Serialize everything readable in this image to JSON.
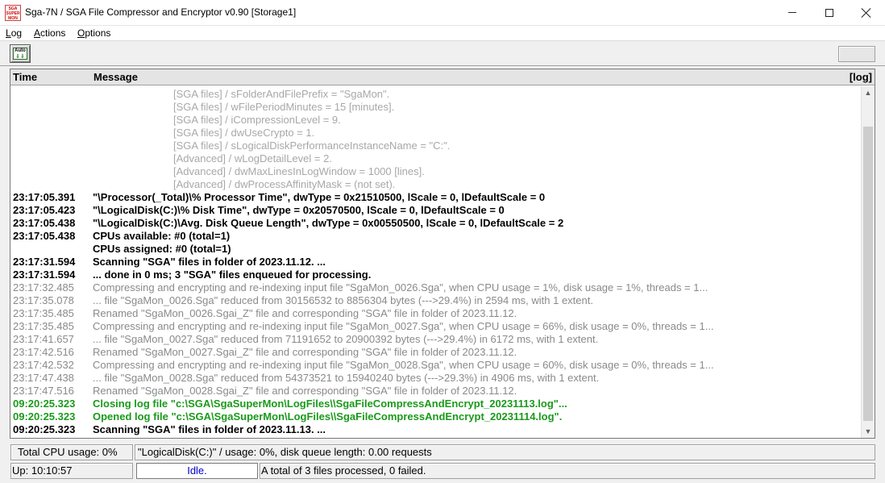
{
  "window": {
    "title": "Sga-7N / SGA File Compressor and Encryptor  v0.90  [Storage1]",
    "icon_lines": [
      "SGA",
      "SUPER",
      "MON"
    ]
  },
  "menu": [
    {
      "accel": "L",
      "rest": "og"
    },
    {
      "accel": "A",
      "rest": "ctions"
    },
    {
      "accel": "O",
      "rest": "ptions"
    }
  ],
  "toolbar": {
    "auto_label": "Auto",
    "auto_arrows": "⇓⇓"
  },
  "list": {
    "headers": {
      "time": "Time",
      "message": "Message",
      "log": "[log]"
    },
    "rows": [
      {
        "style": "cfg",
        "time": "",
        "msg": "[SGA files] / sFolderAndFilePrefix = \"SgaMon\"."
      },
      {
        "style": "cfg",
        "time": "",
        "msg": "[SGA files] / wFilePeriodMinutes = 15 [minutes]."
      },
      {
        "style": "cfg",
        "time": "",
        "msg": "[SGA files] / iCompressionLevel = 9."
      },
      {
        "style": "cfg",
        "time": "",
        "msg": "[SGA files] / dwUseCrypto = 1."
      },
      {
        "style": "cfg",
        "time": "",
        "msg": "[SGA files] / sLogicalDiskPerformanceInstanceName = \"C:\"."
      },
      {
        "style": "cfg",
        "time": "",
        "msg": "[Advanced] / wLogDetailLevel = 2."
      },
      {
        "style": "cfg",
        "time": "",
        "msg": "[Advanced] / dwMaxLinesInLogWindow = 1000 [lines]."
      },
      {
        "style": "cfg",
        "time": "",
        "msg": "[Advanced] / dwProcessAffinityMask = (not set)."
      },
      {
        "style": "black",
        "time": "23:17:05.391",
        "msg": "\"\\Processor(_Total)\\% Processor Time\", dwType = 0x21510500, lScale = 0, lDefaultScale = 0"
      },
      {
        "style": "black",
        "time": "23:17:05.423",
        "msg": "\"\\LogicalDisk(C:)\\% Disk Time\", dwType = 0x20570500, lScale = 0, lDefaultScale = 0"
      },
      {
        "style": "black",
        "time": "23:17:05.438",
        "msg": "\"\\LogicalDisk(C:)\\Avg. Disk Queue Length\", dwType = 0x00550500, lScale = 0, lDefaultScale = 2"
      },
      {
        "style": "black",
        "time": "23:17:05.438",
        "msg": "CPUs available: #0  (total=1)"
      },
      {
        "style": "black",
        "time": "",
        "msg": "CPUs assigned: #0  (total=1)"
      },
      {
        "style": "black",
        "time": "23:17:31.594",
        "msg": "Scanning \"SGA\" files in folder of 2023.11.12. ..."
      },
      {
        "style": "black",
        "time": "23:17:31.594",
        "msg": "... done in 0 ms; 3 \"SGA\" files enqueued for processing."
      },
      {
        "style": "gray",
        "time": "23:17:32.485",
        "msg": "Compressing and encrypting and re-indexing input file \"SgaMon_0026.Sga\", when CPU usage = 1%, disk usage = 1%, threads = 1..."
      },
      {
        "style": "gray",
        "time": "23:17:35.078",
        "msg": "... file \"SgaMon_0026.Sga\" reduced from 30156532 to 8856304 bytes (--->29.4%) in 2594 ms, with 1 extent."
      },
      {
        "style": "gray",
        "time": "23:17:35.485",
        "msg": "Renamed \"SgaMon_0026.Sgai_Z\" file and corresponding \"SGA\" file in folder of 2023.11.12."
      },
      {
        "style": "gray",
        "time": "23:17:35.485",
        "msg": "Compressing and encrypting and re-indexing input file \"SgaMon_0027.Sga\", when CPU usage = 66%, disk usage = 0%, threads = 1..."
      },
      {
        "style": "gray",
        "time": "23:17:41.657",
        "msg": "... file \"SgaMon_0027.Sga\" reduced from 71191652 to 20900392 bytes (--->29.4%) in 6172 ms, with 1 extent."
      },
      {
        "style": "gray",
        "time": "23:17:42.516",
        "msg": "Renamed \"SgaMon_0027.Sgai_Z\" file and corresponding \"SGA\" file in folder of 2023.11.12."
      },
      {
        "style": "gray",
        "time": "23:17:42.532",
        "msg": "Compressing and encrypting and re-indexing input file \"SgaMon_0028.Sga\", when CPU usage = 60%, disk usage = 0%, threads = 1..."
      },
      {
        "style": "gray",
        "time": "23:17:47.438",
        "msg": "... file \"SgaMon_0028.Sga\" reduced from 54373521 to 15940240 bytes (--->29.3%) in 4906 ms, with 1 extent."
      },
      {
        "style": "gray",
        "time": "23:17:47.516",
        "msg": "Renamed \"SgaMon_0028.Sgai_Z\" file and corresponding \"SGA\" file in folder of 2023.11.12."
      },
      {
        "style": "green",
        "time": "09:20:25.323",
        "msg": "Closing log file \"c:\\SGA\\SgaSuperMon\\LogFiles\\\\SgaFileCompressAndEncrypt_20231113.log\"..."
      },
      {
        "style": "green",
        "time": "09:20:25.323",
        "msg": "Opened log file \"c:\\SGA\\SgaSuperMon\\LogFiles\\\\SgaFileCompressAndEncrypt_20231114.log\"."
      },
      {
        "style": "black",
        "time": "09:20:25.323",
        "msg": "Scanning \"SGA\" files in folder of 2023.11.13. ..."
      }
    ]
  },
  "status": {
    "cpu": "Total CPU usage: 0%",
    "disk": "\"LogicalDisk(C:)\" / usage: 0%,  disk queue length: 0.00 requests",
    "uptime": "Up: 10:10:57",
    "state": "Idle.",
    "summary": "A total of 3 files processed,  0 failed."
  }
}
